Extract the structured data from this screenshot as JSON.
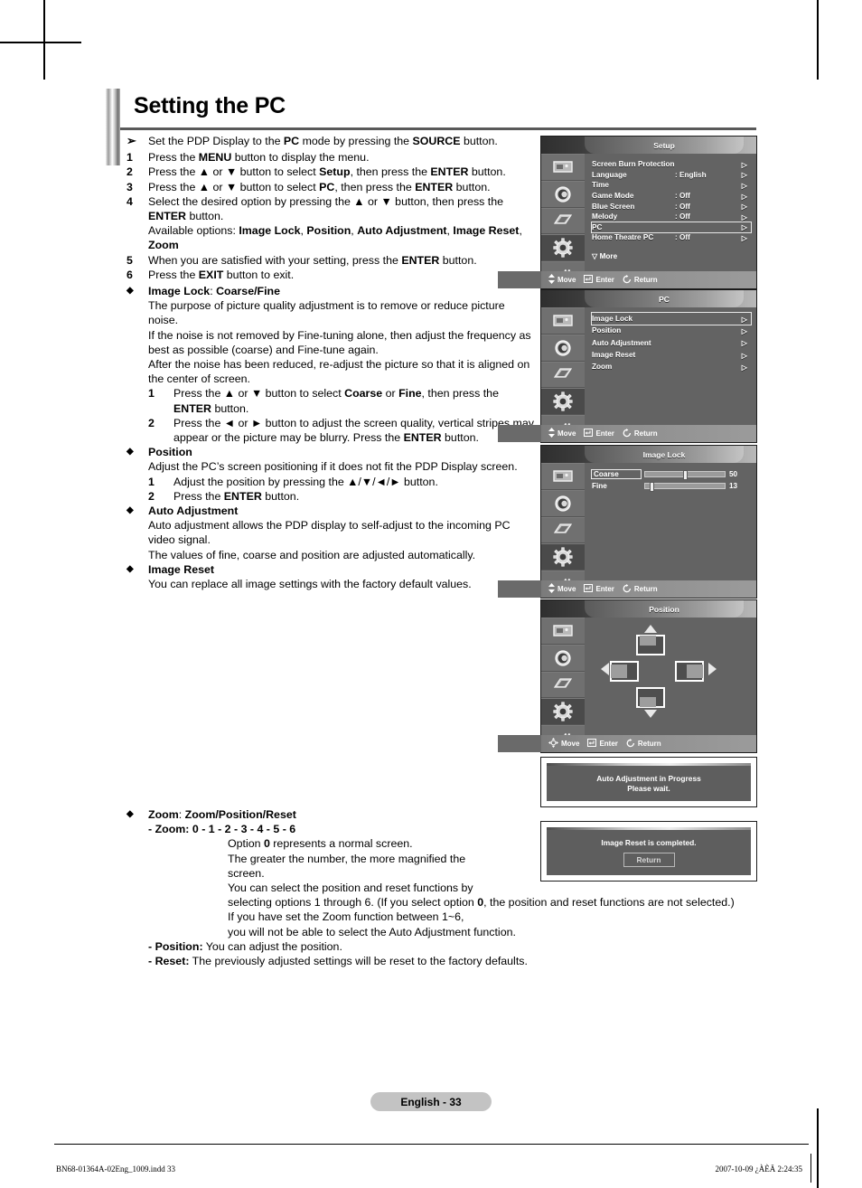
{
  "page": {
    "title": "Setting the PC",
    "page_label": "English - 33",
    "footer_left": "BN68-01364A-02Eng_1009.indd   33",
    "footer_right": "2007-10-09   ¿ÀÈÄ 2:24:35"
  },
  "instructions": {
    "note": {
      "marker": "➢",
      "parts": [
        {
          "t": "Set the PDP Display to the ",
          "b": false
        },
        {
          "t": "PC",
          "b": true
        },
        {
          "t": " mode by pressing the ",
          "b": false
        },
        {
          "t": "SOURCE",
          "b": true
        },
        {
          "t": " button.",
          "b": false
        }
      ]
    },
    "steps": [
      {
        "num": "1",
        "parts": [
          {
            "t": "Press the ",
            "b": false
          },
          {
            "t": "MENU",
            "b": true
          },
          {
            "t": " button to display the menu.",
            "b": false
          }
        ]
      },
      {
        "num": "2",
        "parts": [
          {
            "t": "Press the ▲ or ▼ button to select ",
            "b": false
          },
          {
            "t": "Setup",
            "b": true
          },
          {
            "t": ", then press the ",
            "b": false
          },
          {
            "t": "ENTER",
            "b": true
          },
          {
            "t": " button.",
            "b": false
          }
        ]
      },
      {
        "num": "3",
        "parts": [
          {
            "t": "Press the ▲ or ▼ button to select ",
            "b": false
          },
          {
            "t": "PC",
            "b": true
          },
          {
            "t": ", then press the ",
            "b": false
          },
          {
            "t": "ENTER",
            "b": true
          },
          {
            "t": " button.",
            "b": false
          }
        ]
      },
      {
        "num": "4",
        "parts": [
          {
            "t": "Select the desired option by pressing the ▲ or ▼ button, then press the ",
            "b": false
          },
          {
            "t": "ENTER",
            "b": true
          },
          {
            "t": " button.",
            "b": false
          }
        ],
        "extra": [
          {
            "t": "Available options: ",
            "b": false
          },
          {
            "t": "Image Lock",
            "b": true
          },
          {
            "t": ", ",
            "b": false
          },
          {
            "t": "Position",
            "b": true
          },
          {
            "t": ", ",
            "b": false
          },
          {
            "t": "Auto Adjustment",
            "b": true
          },
          {
            "t": ", ",
            "b": false
          },
          {
            "t": "Image Reset",
            "b": true
          },
          {
            "t": ", ",
            "b": false
          },
          {
            "t": "Zoom",
            "b": true
          }
        ]
      },
      {
        "num": "5",
        "parts": [
          {
            "t": "When you are satisfied with your setting, press the ",
            "b": false
          },
          {
            "t": "ENTER",
            "b": true
          },
          {
            "t": " button.",
            "b": false
          }
        ]
      },
      {
        "num": "6",
        "parts": [
          {
            "t": "Press the ",
            "b": false
          },
          {
            "t": "EXIT",
            "b": true
          },
          {
            "t": " button to exit.",
            "b": false
          }
        ]
      }
    ]
  },
  "sections": {
    "image_lock": {
      "heading": [
        {
          "t": "Image Lock",
          "b": true
        },
        {
          "t": ": ",
          "b": false
        },
        {
          "t": "Coarse/Fine",
          "b": true
        }
      ],
      "body": [
        "The purpose of picture quality adjustment is to remove or reduce picture noise.",
        "If the noise is not removed by Fine-tuning alone, then adjust the frequency as best as possible (coarse) and Fine-tune again.",
        "After the noise has been reduced, re-adjust the picture so that it is aligned on the center of screen."
      ],
      "steps": [
        {
          "num": "1",
          "parts": [
            {
              "t": "Press the ▲ or ▼ button to select ",
              "b": false
            },
            {
              "t": "Coarse",
              "b": true
            },
            {
              "t": " or ",
              "b": false
            },
            {
              "t": "Fine",
              "b": true
            },
            {
              "t": ", then press the ",
              "b": false
            },
            {
              "t": "ENTER",
              "b": true
            },
            {
              "t": " button.",
              "b": false
            }
          ]
        },
        {
          "num": "2",
          "parts": [
            {
              "t": "Press the ◄ or ► button to adjust the screen quality, vertical stripes may appear or the picture may be blurry. Press the ",
              "b": false
            },
            {
              "t": "ENTER",
              "b": true
            },
            {
              "t": " button.",
              "b": false
            }
          ]
        }
      ]
    },
    "position": {
      "heading": [
        {
          "t": "Position",
          "b": true
        }
      ],
      "body": [
        "Adjust the PC’s screen positioning if it does not fit the PDP Display screen."
      ],
      "steps": [
        {
          "num": "1",
          "parts": [
            {
              "t": "Adjust the position by pressing the ▲/▼/◄/► button.",
              "b": false
            }
          ]
        },
        {
          "num": "2",
          "parts": [
            {
              "t": "Press the ",
              "b": false
            },
            {
              "t": "ENTER",
              "b": true
            },
            {
              "t": " button.",
              "b": false
            }
          ]
        }
      ]
    },
    "auto_adjustment": {
      "heading": [
        {
          "t": "Auto Adjustment",
          "b": true
        }
      ],
      "body": [
        "Auto adjustment allows the PDP display to self-adjust to the incoming PC video signal.",
        "The values of fine, coarse and position are adjusted automatically."
      ]
    },
    "image_reset": {
      "heading": [
        {
          "t": "Image Reset",
          "b": true
        }
      ],
      "body": [
        "You can replace all image settings with the factory default values."
      ]
    },
    "zoom": {
      "heading": [
        {
          "t": "Zoom",
          "b": true
        },
        {
          "t": ": ",
          "b": false
        },
        {
          "t": "Zoom/Position/Reset",
          "b": true
        }
      ],
      "sub_heading": [
        {
          "t": "- Zoom: 0 - 1 - 2 - 3 - 4 - 5 - 6",
          "b": true
        }
      ],
      "lines": [
        [
          {
            "t": "Option ",
            "b": false
          },
          {
            "t": "0",
            "b": true
          },
          {
            "t": " represents a normal screen.",
            "b": false
          }
        ],
        [
          {
            "t": "The greater the number, the more magnified the screen.",
            "b": false
          }
        ],
        [
          {
            "t": "You can select the position and reset functions by",
            "b": false
          }
        ]
      ],
      "wide_lines": [
        [
          {
            "t": "selecting options 1 through 6. (If you select option ",
            "b": false
          },
          {
            "t": "0",
            "b": true
          },
          {
            "t": ", the position and reset functions are not selected.)",
            "b": false
          }
        ],
        [
          {
            "t": "If you have set the Zoom function between 1~6,",
            "b": false
          }
        ],
        [
          {
            "t": "you will not be able to select the Auto Adjustment function.",
            "b": false
          }
        ]
      ],
      "tail": [
        [
          {
            "t": "- Position:",
            "b": true
          },
          {
            "t": " You can adjust the position.",
            "b": false
          }
        ],
        [
          {
            "t": "- Reset:",
            "b": true
          },
          {
            "t": " The previously adjusted settings will be reset to the factory defaults.",
            "b": false
          }
        ]
      ]
    }
  },
  "osd": {
    "footer_items": [
      {
        "icon": "updown-arrow-icon",
        "label": "Move"
      },
      {
        "icon": "enter-key-icon",
        "label": "Enter"
      },
      {
        "icon": "return-arrow-icon",
        "label": "Return"
      }
    ],
    "footer_items_pad": [
      {
        "icon": "fourway-arrow-icon",
        "label": "Move"
      },
      {
        "icon": "enter-key-icon",
        "label": "Enter"
      },
      {
        "icon": "return-arrow-icon",
        "label": "Return"
      }
    ],
    "sidebar_icons": [
      "picture-icon",
      "sound-icon",
      "channel-icon",
      "setup-gear-icon",
      "input-plug-icon"
    ],
    "setup": {
      "title": "Setup",
      "items": [
        {
          "label": "Screen Burn Protection",
          "value": "",
          "arrow": "▷",
          "highlighted": false
        },
        {
          "label": "Language",
          "value": ": English",
          "arrow": "▷",
          "highlighted": false
        },
        {
          "label": "Time",
          "value": "",
          "arrow": "▷",
          "highlighted": false
        },
        {
          "label": "Game Mode",
          "value": ": Off",
          "arrow": "▷",
          "highlighted": false
        },
        {
          "label": "Blue Screen",
          "value": ": Off",
          "arrow": "▷",
          "highlighted": false
        },
        {
          "label": "Melody",
          "value": ": Off",
          "arrow": "▷",
          "highlighted": false
        },
        {
          "label": "PC",
          "value": "",
          "arrow": "▷",
          "highlighted": true
        },
        {
          "label": "Home Theatre PC",
          "value": ": Off",
          "arrow": "▷",
          "highlighted": false
        }
      ],
      "more": "▽ More"
    },
    "pc": {
      "title": "PC",
      "items": [
        {
          "label": "Image Lock",
          "arrow": "▷",
          "highlighted": true
        },
        {
          "label": "Position",
          "arrow": "▷",
          "highlighted": false
        },
        {
          "label": "Auto Adjustment",
          "arrow": "▷",
          "highlighted": false
        },
        {
          "label": "Image Reset",
          "arrow": "▷",
          "highlighted": false
        },
        {
          "label": "Zoom",
          "arrow": "▷",
          "highlighted": false
        }
      ]
    },
    "image_lock": {
      "title": "Image Lock",
      "sliders": [
        {
          "label": "Coarse",
          "value": "50",
          "percent": 50,
          "highlighted": true
        },
        {
          "label": "Fine",
          "value": "13",
          "percent": 8,
          "highlighted": false
        }
      ]
    },
    "position": {
      "title": "Position"
    }
  },
  "dialogs": {
    "auto_adjust": {
      "line1": "Auto Adjustment in Progress",
      "line2": "Please wait."
    },
    "image_reset": {
      "line1": "Image Reset is completed.",
      "button": "Return"
    }
  }
}
